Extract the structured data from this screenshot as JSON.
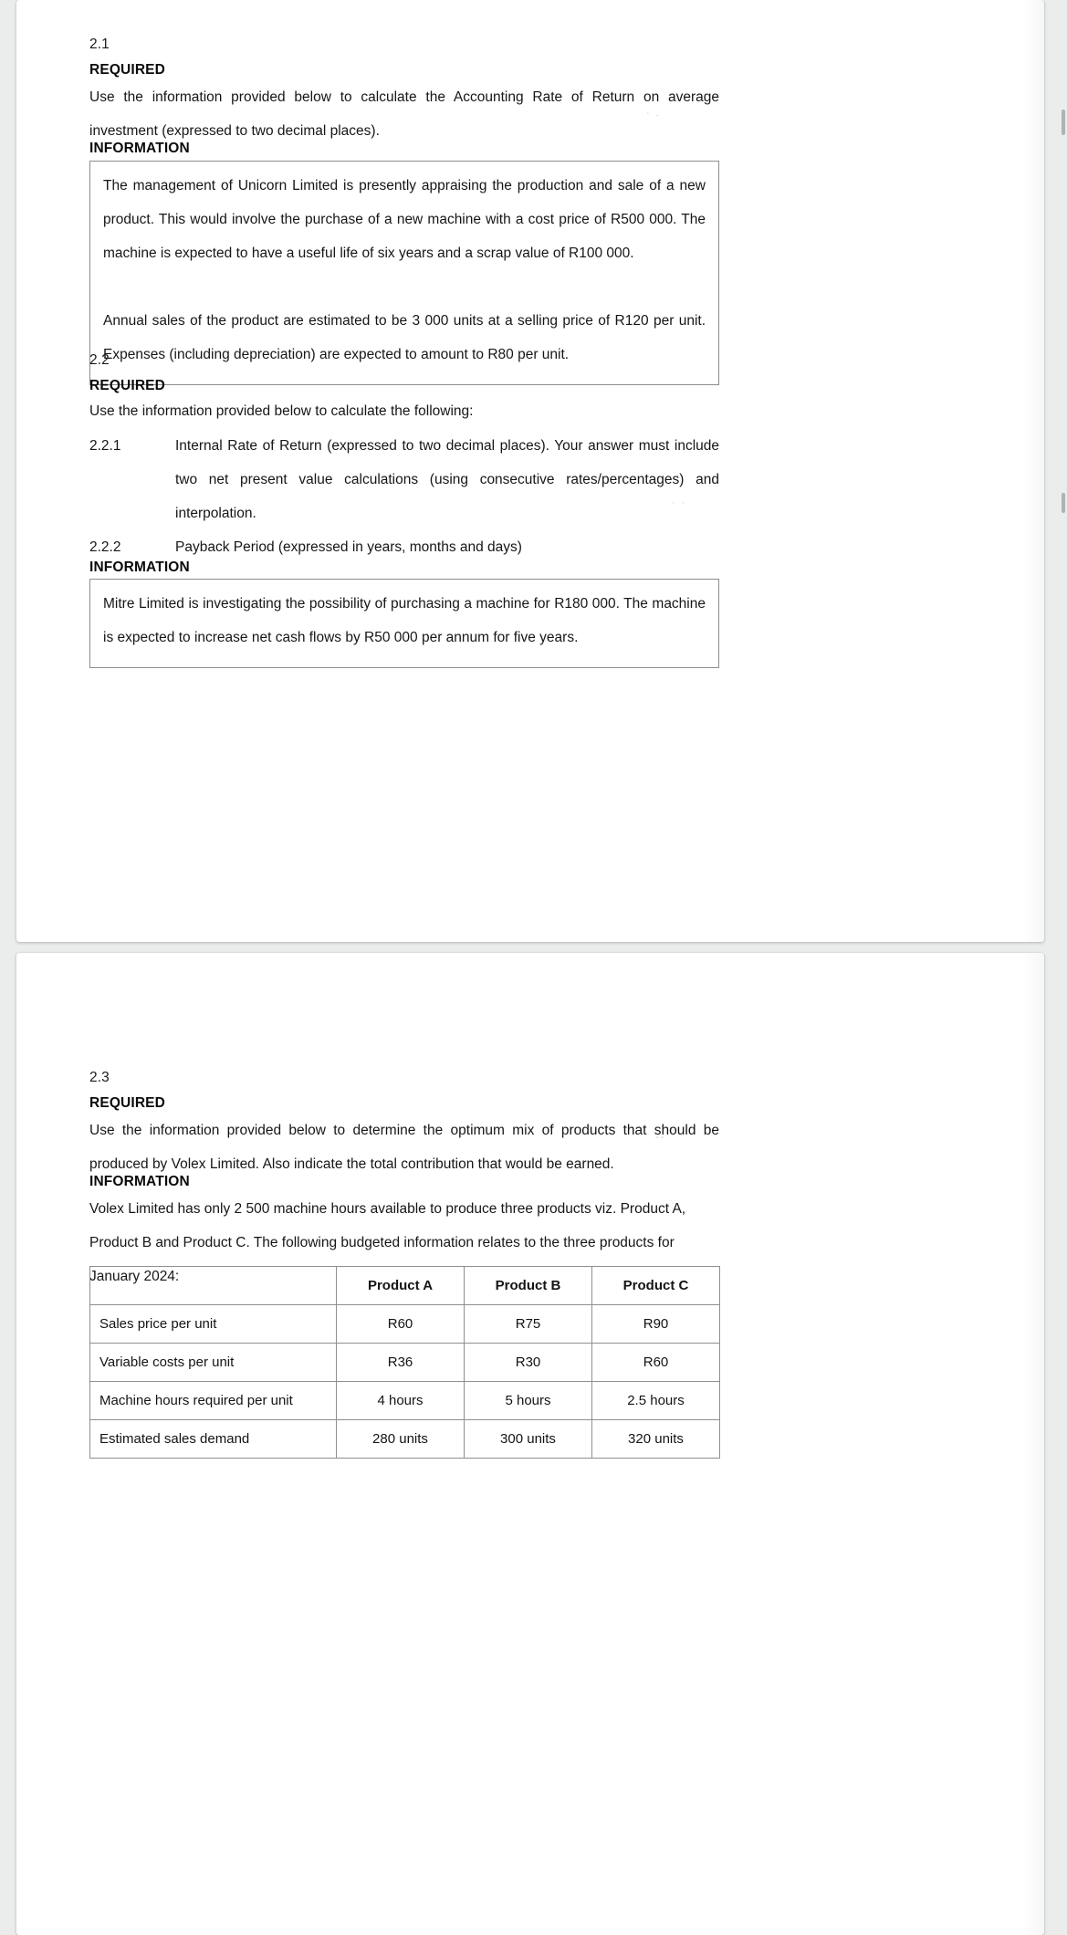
{
  "document": {
    "page1": {
      "q21": {
        "number": "2.1",
        "required_label": "REQUIRED",
        "required_text": "Use the information provided below to calculate the Accounting Rate of Return on average investment (expressed to two decimal places).",
        "information_label": "INFORMATION",
        "info_paragraph_1": "The management of Unicorn Limited is presently appraising the production and sale of a new product.  This would involve the purchase of a new machine with a cost price of R500 000.  The machine is expected to have a useful life of six years and a scrap value of R100 000.",
        "info_paragraph_2": "Annual sales of the product are estimated to be 3 000 units at a selling price of R120 per unit.  Expenses (including depreciation) are expected to amount to R80 per unit."
      },
      "q22": {
        "number": "2.2",
        "required_label": "REQUIRED",
        "required_text": "Use the information provided below to calculate the following:",
        "items": [
          {
            "label": "2.2.1",
            "text": "Internal Rate of Return (expressed to two decimal places).  Your answer must include two net present value calculations (using consecutive rates/percentages) and interpolation."
          },
          {
            "label": "2.2.2",
            "text": "Payback Period (expressed in years, months and days)"
          }
        ],
        "information_label": "INFORMATION",
        "info_paragraph_1": "Mitre Limited is investigating the possibility of purchasing a machine for R180 000.  The machine is expected to increase net cash flows by R50 000 per annum for five years."
      }
    },
    "page2": {
      "q23": {
        "number": "2.3",
        "required_label": "REQUIRED",
        "required_text": "Use the information provided below to determine the optimum mix of products that should be produced by Volex Limited.  Also indicate the total contribution that would be earned.",
        "information_label": "INFORMATION",
        "info_paragraph_1": "Volex Limited has only 2 500 machine hours available to produce three products viz. Product A, Product B and Product C.  The following budgeted information relates to the three products for January 2024:",
        "table": {
          "headers": [
            "",
            "Product A",
            "Product B",
            "Product C"
          ],
          "rows": [
            {
              "label": "Sales price per unit",
              "values": [
                "R60",
                "R75",
                "R90"
              ]
            },
            {
              "label": "Variable costs per unit",
              "values": [
                "R36",
                "R30",
                "R60"
              ]
            },
            {
              "label": "Machine hours required per unit",
              "values": [
                "4 hours",
                "5 hours",
                "2.5 hours"
              ]
            },
            {
              "label": "Estimated sales demand",
              "values": [
                "280 units",
                "300 units",
                "320 units"
              ]
            }
          ]
        }
      }
    }
  },
  "artifacts": {
    "smudge_a": "· .",
    "smudge_b": "· ·",
    "smudge_c": "· ·",
    "smudge_d": "--"
  }
}
